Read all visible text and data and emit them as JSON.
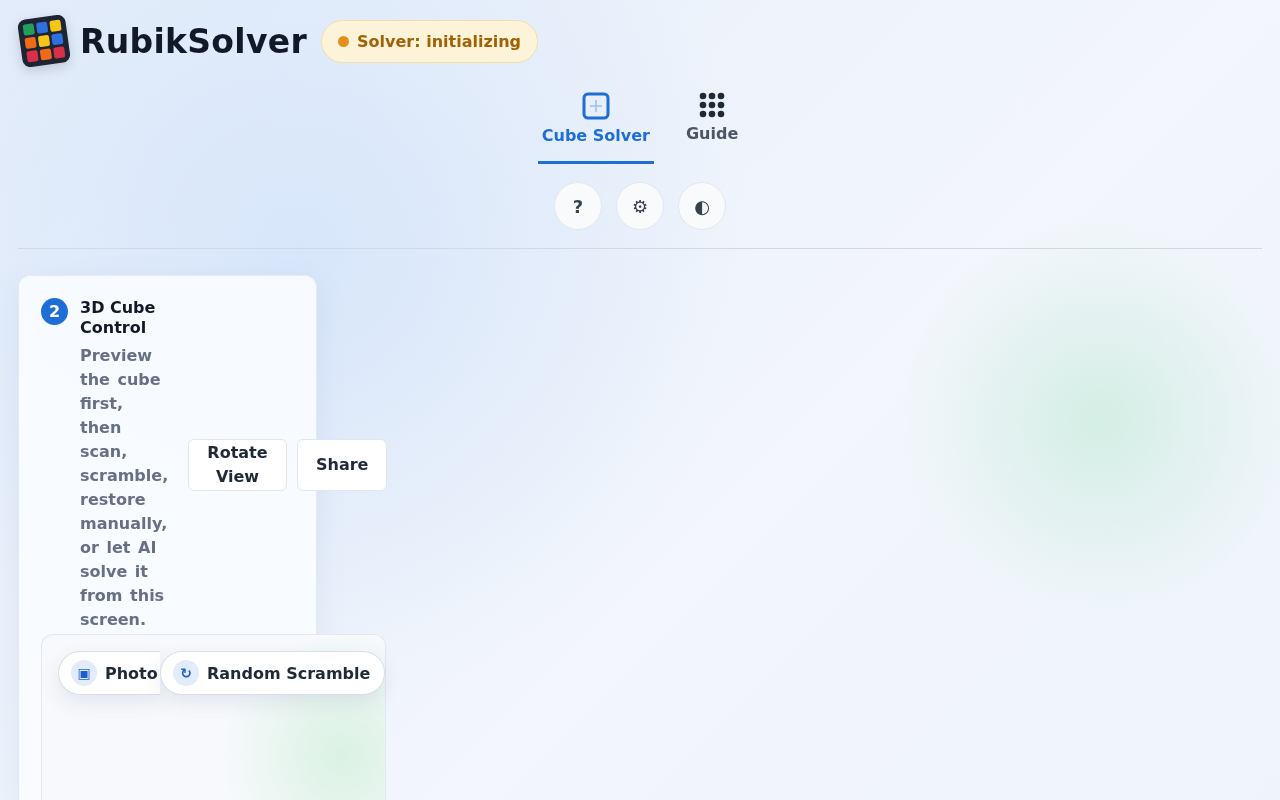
{
  "app": {
    "name": "RubikSolver",
    "status": "Solver: initializing"
  },
  "tabs": [
    {
      "label": "Cube Solver",
      "selected": true
    },
    {
      "label": "Guide",
      "selected": false
    }
  ],
  "tool_buttons": [
    "?",
    "⚙",
    "◐"
  ],
  "step": {
    "number": "2",
    "title": "3D Cube Control",
    "description": "Preview the cube first, then scan, scramble, restore manually, or let AI solve it from this screen.",
    "actions": [
      "Rotate View",
      "Share"
    ]
  },
  "mode_buttons": [
    {
      "label": "Photo",
      "icon": "▣"
    },
    {
      "label": "Random Scramble",
      "icon": "↻"
    }
  ]
}
